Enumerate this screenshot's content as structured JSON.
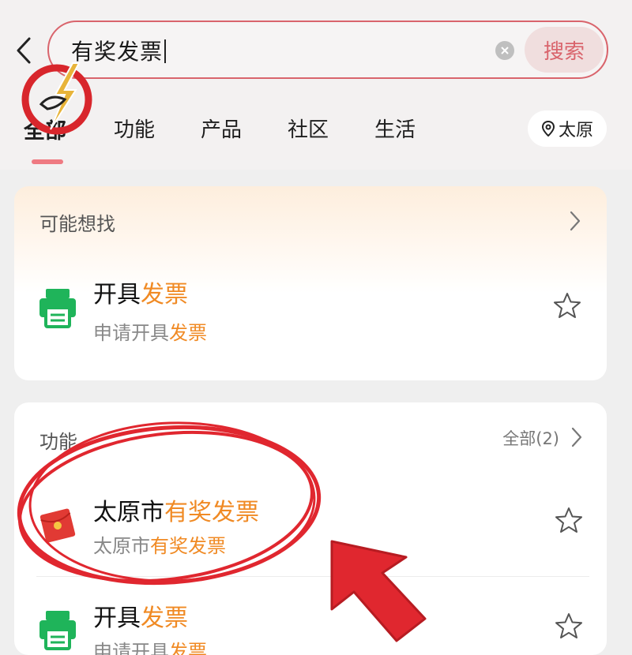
{
  "search": {
    "query": "有奖发票",
    "button_label": "搜索"
  },
  "tabs": [
    {
      "label": "全部",
      "active": true
    },
    {
      "label": "功能",
      "active": false
    },
    {
      "label": "产品",
      "active": false
    },
    {
      "label": "社区",
      "active": false
    },
    {
      "label": "生活",
      "active": false
    }
  ],
  "location": {
    "label": "太原"
  },
  "suggest_card": {
    "title": "可能想找",
    "item": {
      "title_plain": "开具",
      "title_highlight": "发票",
      "sub_plain": "申请开具",
      "sub_highlight": "发票"
    }
  },
  "functions_card": {
    "title": "功能",
    "more_label": "全部(2)",
    "items": [
      {
        "title_plain": "太原市",
        "title_highlight": "有奖发票",
        "sub_plain": "太原市",
        "sub_highlight": "有奖发票",
        "icon": "red-envelope-icon"
      },
      {
        "title_plain": "开具",
        "title_highlight": "发票",
        "sub_plain": "申请开具",
        "sub_highlight": "发票",
        "icon": "invoice-printer-icon"
      }
    ]
  },
  "colors": {
    "accent_red": "#d9646c",
    "highlight_orange": "#f08a24",
    "icon_green": "#1fb45a",
    "annotation_red": "#e0272f"
  }
}
